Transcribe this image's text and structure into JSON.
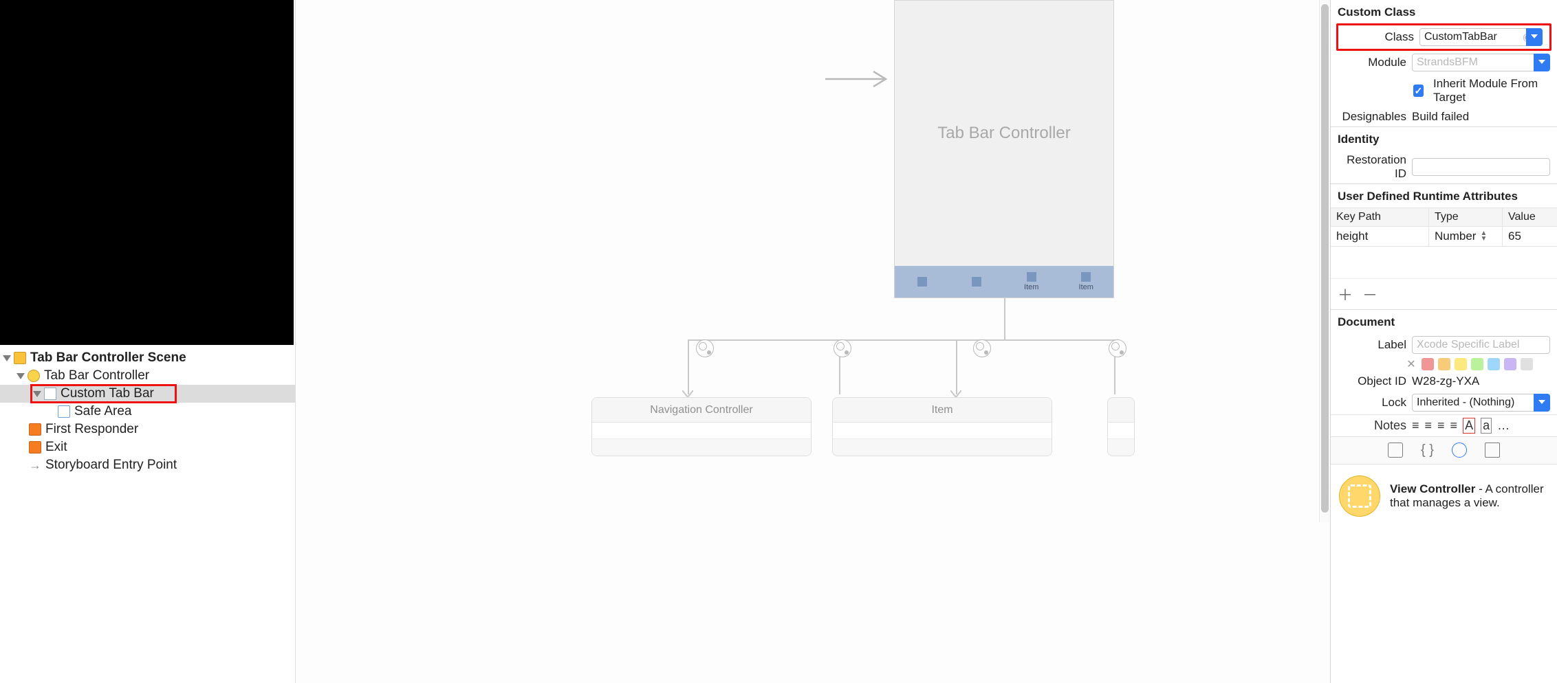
{
  "outline": {
    "scene": "Tab Bar Controller Scene",
    "items": [
      "Tab Bar Controller",
      "Custom Tab Bar",
      "Safe Area",
      "First Responder",
      "Exit",
      "Storyboard Entry Point"
    ]
  },
  "canvas": {
    "phone_title": "Tab Bar Controller",
    "tab_items": [
      "",
      "",
      "Item",
      "Item"
    ],
    "child_scenes": [
      "Navigation Controller",
      "Item"
    ]
  },
  "inspector": {
    "custom_class": {
      "header": "Custom Class",
      "class_label": "Class",
      "class_value": "CustomTabBar",
      "module_label": "Module",
      "module_placeholder": "StrandsBFM",
      "inherit_label": "Inherit Module From Target",
      "designables_label": "Designables",
      "designables_value": "Build failed"
    },
    "identity": {
      "header": "Identity",
      "restoration_label": "Restoration ID"
    },
    "runtime": {
      "header": "User Defined Runtime Attributes",
      "cols": [
        "Key Path",
        "Type",
        "Value"
      ],
      "row": {
        "key": "height",
        "type": "Number",
        "value": "65"
      }
    },
    "document": {
      "header": "Document",
      "label_label": "Label",
      "label_placeholder": "Xcode Specific Label",
      "object_id_label": "Object ID",
      "object_id_value": "W28-zg-YXA",
      "lock_label": "Lock",
      "lock_value": "Inherited - (Nothing)",
      "notes_label": "Notes",
      "swatch_colors": [
        "#f19696",
        "#f7cb7a",
        "#fbe97d",
        "#baf29b",
        "#9fd6fb",
        "#c9b6f4",
        "#e0e0e0"
      ]
    },
    "library": {
      "title": "View Controller",
      "desc": " - A controller that manages a view."
    }
  }
}
